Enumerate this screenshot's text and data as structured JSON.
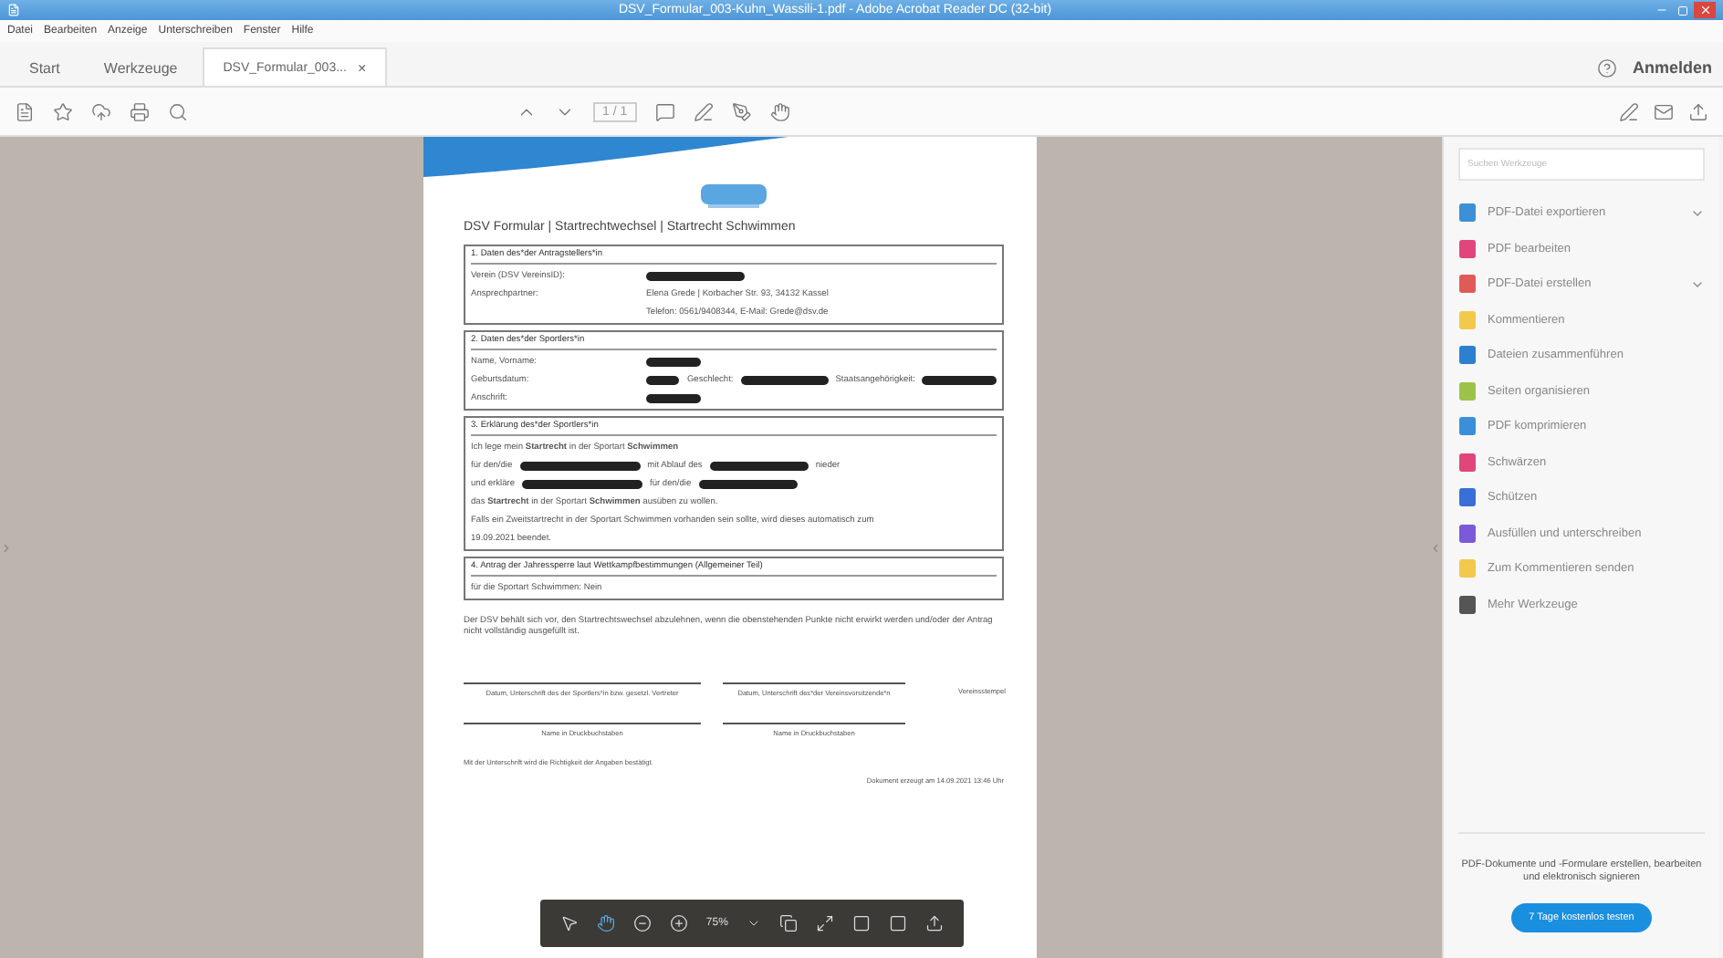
{
  "window": {
    "title": "DSV_Formular_003-Kuhn_Wassili-1.pdf - Adobe Acrobat Reader DC (32-bit)"
  },
  "menu": [
    "Datei",
    "Bearbeiten",
    "Anzeige",
    "Unterschreiben",
    "Fenster",
    "Hilfe"
  ],
  "tabs": [
    {
      "label": "Start",
      "selected": false,
      "closable": false
    },
    {
      "label": "Werkzeuge",
      "selected": false,
      "closable": false
    },
    {
      "label": "DSV_Formular_003...",
      "selected": true,
      "closable": true
    }
  ],
  "tab_close": "×",
  "account": {
    "label": "Anmelden"
  },
  "page_indicator": "1 / 1",
  "document": {
    "heading": "DSV Formular | Startrechtwechsel | Startrecht Schwimmen",
    "sections": [
      {
        "title": "1. Daten des*der Antragstellers*in",
        "lines": [
          [
            {
              "kind": "label",
              "text": "Verein (DSV VereinsID):"
            },
            {
              "kind": "redacted"
            }
          ],
          [
            {
              "kind": "label",
              "text": "Ansprechpartner:"
            },
            {
              "kind": "text",
              "text": "Elena Grede | Korbacher Str. 93, 34132 Kassel"
            }
          ],
          [
            {
              "kind": "spacer"
            },
            {
              "kind": "text",
              "text": "Telefon: 0561/9408344, E-Mail: Grede@dsv.de"
            }
          ]
        ]
      },
      {
        "title": "2. Daten des*der Sportlers*in",
        "lines": [
          [
            {
              "kind": "label",
              "text": "Name, Vorname:"
            },
            {
              "kind": "redacted"
            }
          ],
          [
            {
              "kind": "label",
              "text": "Geburtsdatum:"
            },
            {
              "kind": "redacted"
            },
            {
              "kind": "text",
              "text": "Geschlecht:"
            },
            {
              "kind": "redacted"
            },
            {
              "kind": "text",
              "text": "Staatsangehörigkeit:"
            },
            {
              "kind": "redacted"
            }
          ],
          [
            {
              "kind": "label",
              "text": "Anschrift:"
            },
            {
              "kind": "redacted"
            }
          ]
        ]
      },
      {
        "title": "3. Erklärung des*der Sportlers*in",
        "lines": [
          [
            {
              "kind": "text",
              "text": "Ich lege mein **Startrecht** in der Sportart **Schwimmen**"
            }
          ],
          [
            {
              "kind": "text",
              "text": "für den/die"
            },
            {
              "kind": "redacted"
            },
            {
              "kind": "text",
              "text": "mit Ablauf des"
            },
            {
              "kind": "redacted"
            },
            {
              "kind": "text",
              "text": "nieder"
            }
          ],
          [
            {
              "kind": "text",
              "text": "und erkläre"
            },
            {
              "kind": "redacted"
            },
            {
              "kind": "text",
              "text": "für den/die"
            },
            {
              "kind": "redacted"
            }
          ],
          [
            {
              "kind": "text",
              "text": "das **Startrecht** in der Sportart **Schwimmen** ausüben zu wollen."
            }
          ],
          [
            {
              "kind": "text",
              "text": "Falls ein Zweitstartrecht in der Sportart Schwimmen vorhanden sein sollte, wird dieses automatisch zum"
            }
          ],
          [
            {
              "kind": "text",
              "text": "19.09.2021 beendet."
            }
          ]
        ]
      },
      {
        "title": "4. Antrag der Jahressperre laut Wettkampfbestimmungen (Allgemeiner Teil)",
        "lines": [
          [
            {
              "kind": "text",
              "text": "für die Sportart Schwimmen: Nein"
            }
          ]
        ]
      }
    ],
    "note": "Der DSV behält sich vor, den Startrechtswechsel abzulehnen, wenn die obenstehenden Punkte nicht erwirkt werden und/oder der Antrag nicht vollständig ausgefüllt ist.",
    "signatures": [
      {
        "caption": "Datum, Unterschrift des der Sportlers*in bzw. gesetzl. Vertreter",
        "lined": true
      },
      {
        "caption": "Datum, Unterschrift des*der Vereinsvorsitzende*n",
        "lined": true
      },
      {
        "caption": "Vereinsstempel",
        "lined": false
      },
      {
        "caption": "Name in Druckbuchstaben",
        "lined": true
      },
      {
        "caption": "Name in Druckbuchstaben",
        "lined": true
      }
    ],
    "confirmation": "Mit der Unterschrift wird die Richtigkeit der Angaben bestätigt.",
    "generated": "Dokument erzeugt am 14.09.2021 13:46 Uhr"
  },
  "zoom_level": "75%",
  "sidebar": {
    "search": {
      "placeholder": "Suchen Werkzeuge"
    },
    "tools": [
      {
        "label": "PDF-Datei exportieren",
        "color": "#3d8fd6",
        "expandable": true
      },
      {
        "label": "PDF bearbeiten",
        "color": "#e0457b",
        "expandable": false
      },
      {
        "label": "PDF-Datei erstellen",
        "color": "#e05a5a",
        "expandable": true
      },
      {
        "label": "Kommentieren",
        "color": "#f2c94c",
        "expandable": false
      },
      {
        "label": "Dateien zusammenführen",
        "color": "#2d7fd0",
        "expandable": false
      },
      {
        "label": "Seiten organisieren",
        "color": "#9bc34a",
        "expandable": false
      },
      {
        "label": "PDF komprimieren",
        "color": "#3a8fd8",
        "expandable": false
      },
      {
        "label": "Schwärzen",
        "color": "#e0457b",
        "expandable": false
      },
      {
        "label": "Schützen",
        "color": "#3a6fd8",
        "expandable": false
      },
      {
        "label": "Ausfüllen und unterschreiben",
        "color": "#7a5ad8",
        "expandable": false
      },
      {
        "label": "Zum Kommentieren senden",
        "color": "#f2c94c",
        "expandable": false
      },
      {
        "label": "Mehr Werkzeuge",
        "color": "#555555",
        "expandable": false
      }
    ],
    "promo": "PDF-Dokumente und -Formulare erstellen, bearbeiten und elektronisch signieren",
    "trial_button": "7 Tage kostenlos testen"
  }
}
